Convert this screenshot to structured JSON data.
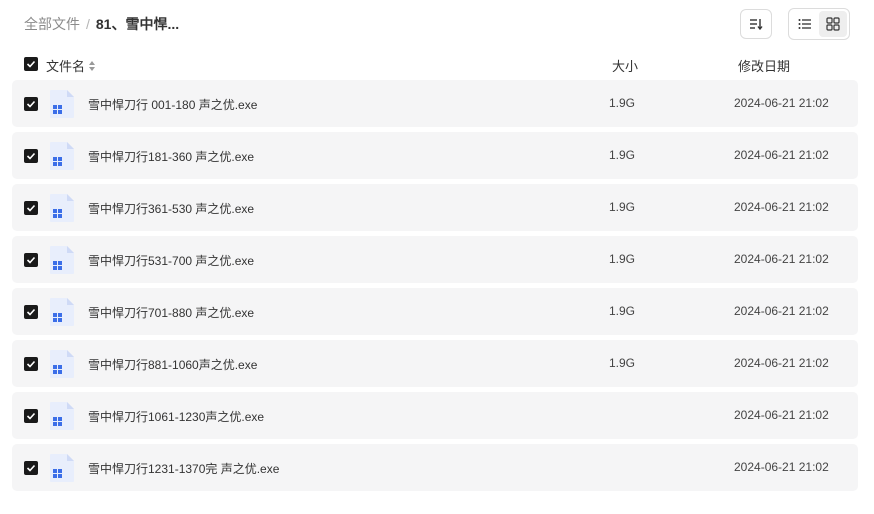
{
  "breadcrumb": {
    "root": "全部文件",
    "separator": "/",
    "current": "81、雪中悍..."
  },
  "toolbar": {
    "sort_icon": "sort-icon",
    "list_view_icon": "list-view-icon",
    "grid_view_icon": "grid-view-icon",
    "active_view": "grid"
  },
  "table": {
    "headers": {
      "name": "文件名",
      "size": "大小",
      "date": "修改日期"
    },
    "rows": [
      {
        "name": "雪中悍刀行 001-180 声之优.exe",
        "size": "1.9G",
        "date": "2024-06-21 21:02",
        "checked": true
      },
      {
        "name": "雪中悍刀行181-360 声之优.exe",
        "size": "1.9G",
        "date": "2024-06-21 21:02",
        "checked": true
      },
      {
        "name": "雪中悍刀行361-530 声之优.exe",
        "size": "1.9G",
        "date": "2024-06-21 21:02",
        "checked": true
      },
      {
        "name": "雪中悍刀行531-700 声之优.exe",
        "size": "1.9G",
        "date": "2024-06-21 21:02",
        "checked": true
      },
      {
        "name": "雪中悍刀行701-880 声之优.exe",
        "size": "1.9G",
        "date": "2024-06-21 21:02",
        "checked": true
      },
      {
        "name": "雪中悍刀行881-1060声之优.exe",
        "size": "1.9G",
        "date": "2024-06-21 21:02",
        "checked": true
      },
      {
        "name": "雪中悍刀行1061-1230声之优.exe",
        "size": "",
        "date": "2024-06-21 21:02",
        "checked": true
      },
      {
        "name": "雪中悍刀行1231-1370完 声之优.exe",
        "size": "",
        "date": "2024-06-21 21:02",
        "checked": true
      }
    ]
  },
  "colors": {
    "row_bg": "#f5f5f6",
    "checkbox": "#1a1a1a",
    "file_icon_accent": "#3b6ee8"
  }
}
